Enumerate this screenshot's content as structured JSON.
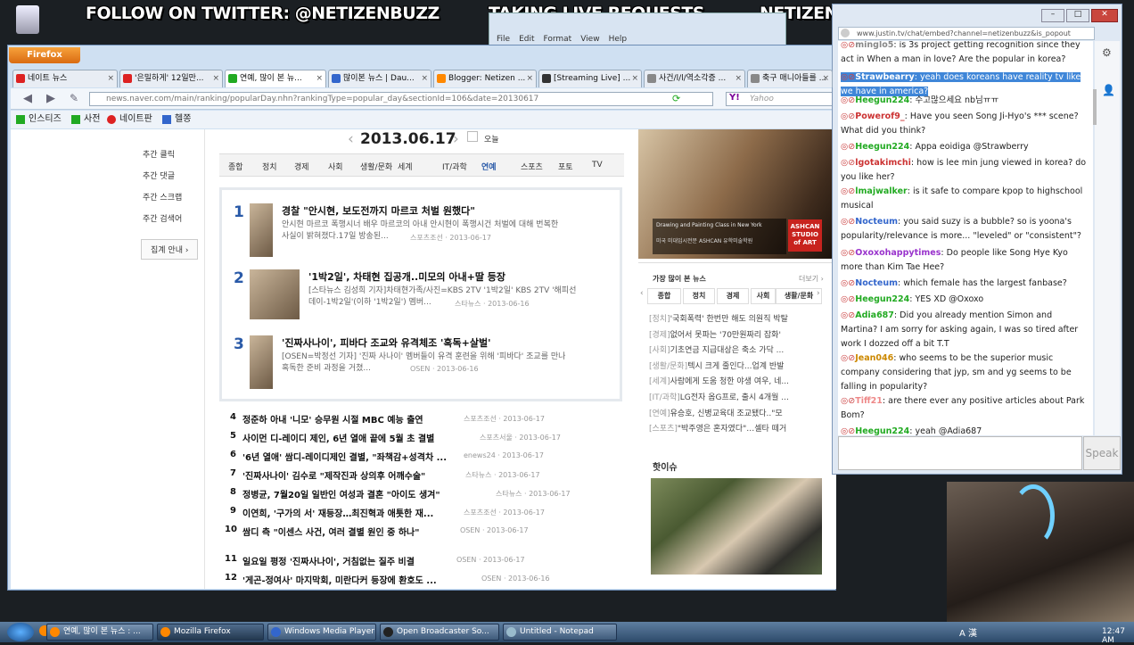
{
  "overlay": {
    "twitter": "FOLLOW ON TWITTER: @NETIZENBUZZ",
    "requests": "TAKING LIVE REQUESTS",
    "blog": "NETIZENBUZZ.BLOGSPOT.COM"
  },
  "notepad": {
    "menu": [
      "File",
      "Edit",
      "Format",
      "View",
      "Help"
    ]
  },
  "firefox": {
    "button": "Firefox",
    "tabs": [
      {
        "label": "네이트 뉴스",
        "color": "#d22"
      },
      {
        "label": "'은밀하게' 12일만...",
        "color": "#d22"
      },
      {
        "label": "연예, 많이 본 뉴...",
        "color": "#2a2",
        "active": true
      },
      {
        "label": "많이본 뉴스 | Dau...",
        "color": "#36c"
      },
      {
        "label": "Blogger: Netizen ...",
        "color": "#f80"
      },
      {
        "label": "[Streaming Live] ...",
        "color": "#333"
      },
      {
        "label": "사건/l/l/역소각증 ...",
        "color": "#888"
      },
      {
        "label": "축구 매니아들를 ...",
        "color": "#888"
      }
    ],
    "url": "news.naver.com/main/ranking/popularDay.nhn?rankingType=popular_day&sectionId=106&date=20130617",
    "search_placeholder": "Yahoo",
    "bookmarks": [
      "인스티즈",
      "사전",
      "네이트판",
      "헬쫑"
    ]
  },
  "naver": {
    "sidebar": [
      "추간 클릭",
      "추간 댓글",
      "주간 스크랩",
      "주간 검색어"
    ],
    "sidebar_btn": "집계 안내 ›",
    "date": "2013.06.17",
    "today": "오늘",
    "categories": [
      "종합",
      "정치",
      "경제",
      "사회",
      "생활/문화",
      "세계",
      "IT/과학",
      "연예",
      "스포츠",
      "포토",
      "TV"
    ],
    "top": [
      {
        "num": "1",
        "title": "경찰 \"안시현, 보도전까지 마르코 처벌 원했다\"",
        "desc1": "안시현 마르코 폭행시너 배우 마르코의 아내 안시현이 폭행시건 처벌에 대해 번복한",
        "desc2": "사실이 밝혀졌다.17일 방송된...",
        "src": "스포츠조선 · 2013-06-17"
      },
      {
        "num": "2",
        "title": "'1박2일', 차태현 집공개..미모의 아내+딸 등장",
        "desc1": "[스타뉴스 김성희 기자]차태현가족/사진=KBS 2TV '1박2일' KBS 2TV '해피선",
        "desc2": "데이-1박2일'(이하 '1박2일') 멤버...",
        "src": "스타뉴스 · 2013-06-16"
      },
      {
        "num": "3",
        "title": "'진짜사나이', 피바다 조교와 유격체조 '혹독+살벌'",
        "desc1": "[OSEN=박정선 기자] '진짜 사나이' 멤버들이 유격 훈련을 위해 '피바다' 조교를 만나",
        "desc2": "혹독한 준비 과정을 거쳤...",
        "src": "OSEN · 2013-06-16"
      }
    ],
    "list": [
      {
        "num": "4",
        "title": "정준하 아내 '니모' 승무원 시절 MBC 예능 출연",
        "src": "스포츠조선 · 2013-06-17"
      },
      {
        "num": "5",
        "title": "사이먼 디-레이디 제인, 6년 열애 끝에 5월 초 결별",
        "src": "스포츠서울 · 2013-06-17"
      },
      {
        "num": "6",
        "title": "'6년 열애' 쌈디-레이디제인 결별, \"좌책감+성격차 ...",
        "src": "enews24 · 2013-06-17"
      },
      {
        "num": "7",
        "title": "'진짜사나이' 김수로 \"제작진과 상의후 어깨수술\"",
        "src": "스타뉴스 · 2013-06-17"
      },
      {
        "num": "8",
        "title": "정병균, 7월20일 일반인 여성과 결혼 \"아이도 생겨\"",
        "src": "스타뉴스 · 2013-06-17"
      },
      {
        "num": "9",
        "title": "이연희, '구가의 서' 재등장…최진혁과 애틋한 재...",
        "src": "스포츠조선 · 2013-06-17"
      },
      {
        "num": "10",
        "title": "쌈디 측 \"이센스 사건, 여러 결별 원인 중 하나\"",
        "src": "OSEN · 2013-06-17"
      },
      {
        "num": "11",
        "title": "일요일 평정 '진짜사나이', 거침없는 질주 비결",
        "src": "OSEN · 2013-06-17"
      },
      {
        "num": "12",
        "title": "'게곤-정여사' 마지막회, 미란다커 등장에 환호도 ...",
        "src": "OSEN · 2013-06-16"
      }
    ],
    "ad_text": "Drawing and Painting Class in New York",
    "ad_sub": "미국 미대입시전문 ASHCAN 유학미술학원",
    "ad_logo": "ASHCAN STUDIO of ART",
    "right_title": "가장 많이 본 뉴스",
    "right_more": "더보기 ›",
    "right_tabs": [
      "종합",
      "정치",
      "경제",
      "사회",
      "생활/문화"
    ],
    "right_items": [
      {
        "cat": "[정치]",
        "text": "'국회폭력' 한번만 해도 의원직 박탈"
      },
      {
        "cat": "[경제]",
        "text": "없어서 못파는 '70만원짜리 잡화'"
      },
      {
        "cat": "[사회]",
        "text": "기초연금 지급대상은 축소 가닥 ..."
      },
      {
        "cat": "[생활/문화]",
        "text": "텍시 크게 줄인다...업계 반발"
      },
      {
        "cat": "[세계]",
        "text": "사람에게 도움 청한 야생 여우, 네..."
      },
      {
        "cat": "[IT/과학]",
        "text": "LG전자 옵G프로, 출시 4개월 ..."
      },
      {
        "cat": "[연예]",
        "text": "유승호, 신병교육대 조교됐다..\"모"
      },
      {
        "cat": "[스포츠]",
        "text": "\"박주영은 혼자였다\"…셀타 떼거"
      }
    ],
    "hot_title": "핫이슈"
  },
  "chat": {
    "url": "www.justin.tv/chat/embed?channel=netizenbuzz&is_popout",
    "speak": "Speak",
    "messages": [
      {
        "user": "minglo5",
        "text": "is 3s project getting recognition since they act in When a man in love? Are the popular in korea?",
        "color": "#888"
      },
      {
        "user": "Strawbearry",
        "text": "yeah does koreans have reality tv like we have in america?",
        "color": "#fff",
        "sel": true
      },
      {
        "user": "Heegun224",
        "text": "수고많으세요 nb님ㅠㅠ",
        "color": "#2a2"
      },
      {
        "user": "Powerof9_",
        "text": "Have you seen Song Ji-Hyo's *** scene? What did you think?",
        "color": "#c33"
      },
      {
        "user": "Heegun224",
        "text": "Appa eoidiga @Strawberry",
        "color": "#2a2"
      },
      {
        "user": "lgotakimchi",
        "text": "how is lee min jung viewed in korea? do you like her?",
        "color": "#c33"
      },
      {
        "user": "lmajwalker",
        "text": "is it safe to compare kpop to highschool musical",
        "color": "#2a2"
      },
      {
        "user": "Nocteum",
        "text": "you said suzy is a bubble? so is yoona's popularity/relevance is more... \"leveled\" or \"consistent\"?",
        "color": "#36c"
      },
      {
        "user": "Oxoxohappytimes",
        "text": "Do people like Song Hye Kyo more than Kim Tae Hee?",
        "color": "#93c"
      },
      {
        "user": "Nocteum",
        "text": "which female has the largest fanbase?",
        "color": "#36c"
      },
      {
        "user": "Heegun224",
        "text": "YES XD @Oxoxo",
        "color": "#2a2"
      },
      {
        "user": "Adia687",
        "text": "Did you already mention Simon and Martina? I am sorry for asking again, I was so tired after work I dozzed off a bit T.T",
        "color": "#2a2"
      },
      {
        "user": "Jean046",
        "text": "who seems to be the superior music company considering that jyp, sm and yg seems to be falling in popularity?",
        "color": "#c80"
      },
      {
        "user": "Tiff21",
        "text": "are there ever any positive articles about Park Bom?",
        "color": "#e88"
      },
      {
        "user": "Heegun224",
        "text": "yeah @Adia687",
        "color": "#2a2"
      }
    ]
  },
  "taskbar": {
    "items": [
      {
        "label": "연예, 많이 본 뉴스 : ...",
        "color": "#f80"
      },
      {
        "label": "Mozilla Firefox",
        "color": "#f80"
      },
      {
        "label": "Windows Media Player",
        "color": "#36c"
      },
      {
        "label": "Open Broadcaster So...",
        "color": "#222"
      },
      {
        "label": "Untitled - Notepad",
        "color": "#9bc"
      }
    ],
    "clock": "12:47 AM",
    "ime": "A 漢"
  }
}
